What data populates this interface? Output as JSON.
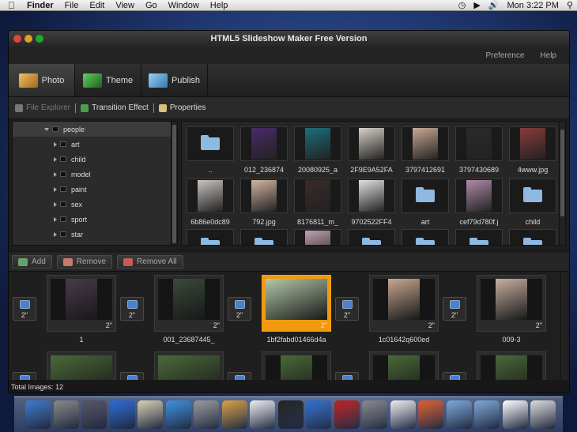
{
  "menubar": {
    "apple_icon": "apple-icon",
    "app_name": "Finder",
    "items": [
      "File",
      "Edit",
      "View",
      "Go",
      "Window",
      "Help"
    ],
    "clock": "Mon 3:22 PM"
  },
  "window": {
    "title": "HTML5 Slideshow Maker Free Version",
    "links": {
      "preference": "Preference",
      "help": "Help"
    },
    "tabs": [
      {
        "label": "Photo",
        "color": "#e5a940",
        "active": true
      },
      {
        "label": "Theme",
        "color": "#3fa040",
        "active": false
      },
      {
        "label": "Publish",
        "color": "#4a90c8",
        "active": false
      }
    ],
    "subtabs": {
      "file_explorer": "File Explorer",
      "transition": "Transition Effect",
      "properties": "Properties"
    }
  },
  "tree": {
    "root": "people",
    "items": [
      "art",
      "child",
      "model",
      "paint",
      "sex",
      "sport",
      "star"
    ]
  },
  "grid": {
    "rows": [
      [
        {
          "type": "folder",
          "name": ".."
        },
        {
          "type": "photo",
          "name": "012_236874",
          "color": "#4a2a6a"
        },
        {
          "type": "photo",
          "name": "20080925_a",
          "color": "#1a6f7a"
        },
        {
          "type": "photo",
          "name": "2F9E9A52FA",
          "color": "#d6d0c8"
        },
        {
          "type": "photo",
          "name": "3797412691",
          "color": "#c9a996"
        },
        {
          "type": "photo",
          "name": "3797430689",
          "color": "#2a2a2a"
        },
        {
          "type": "photo",
          "name": "4www.jpg",
          "color": "#8a3a3a"
        }
      ],
      [
        {
          "type": "photo",
          "name": "6b86e0dc89",
          "color": "#c8c4c0"
        },
        {
          "type": "photo",
          "name": "792.jpg",
          "color": "#d2b4a0"
        },
        {
          "type": "photo",
          "name": "8176811_m_",
          "color": "#3a2a2a"
        },
        {
          "type": "photo",
          "name": "9702522FF4",
          "color": "#e0e0e0"
        },
        {
          "type": "folder",
          "name": "art"
        },
        {
          "type": "photo",
          "name": "cef79d780f.j",
          "color": "#b08aa8"
        },
        {
          "type": "folder",
          "name": "child"
        }
      ]
    ]
  },
  "buttons": {
    "add": "Add",
    "remove": "Remove",
    "remove_all": "Remove All"
  },
  "timeline": {
    "transition_duration": "2\"",
    "slides": [
      {
        "caption": "1",
        "duration": "2\"",
        "color": "#4a3a4a",
        "selected": false
      },
      {
        "caption": "001_23687445_",
        "duration": "2\"",
        "color": "#3a4a3a",
        "selected": false
      },
      {
        "caption": "1bf2fabd01466d4a",
        "duration": "2\"",
        "color": "#b4c8a8",
        "selected": true
      },
      {
        "caption": "1c01642q600ed",
        "duration": "2\"",
        "color": "#c8a890",
        "selected": false
      },
      {
        "caption": "009-3",
        "duration": "2\"",
        "color": "#c8b0a0",
        "selected": false
      }
    ]
  },
  "status": {
    "total": "Total Images: 12"
  }
}
